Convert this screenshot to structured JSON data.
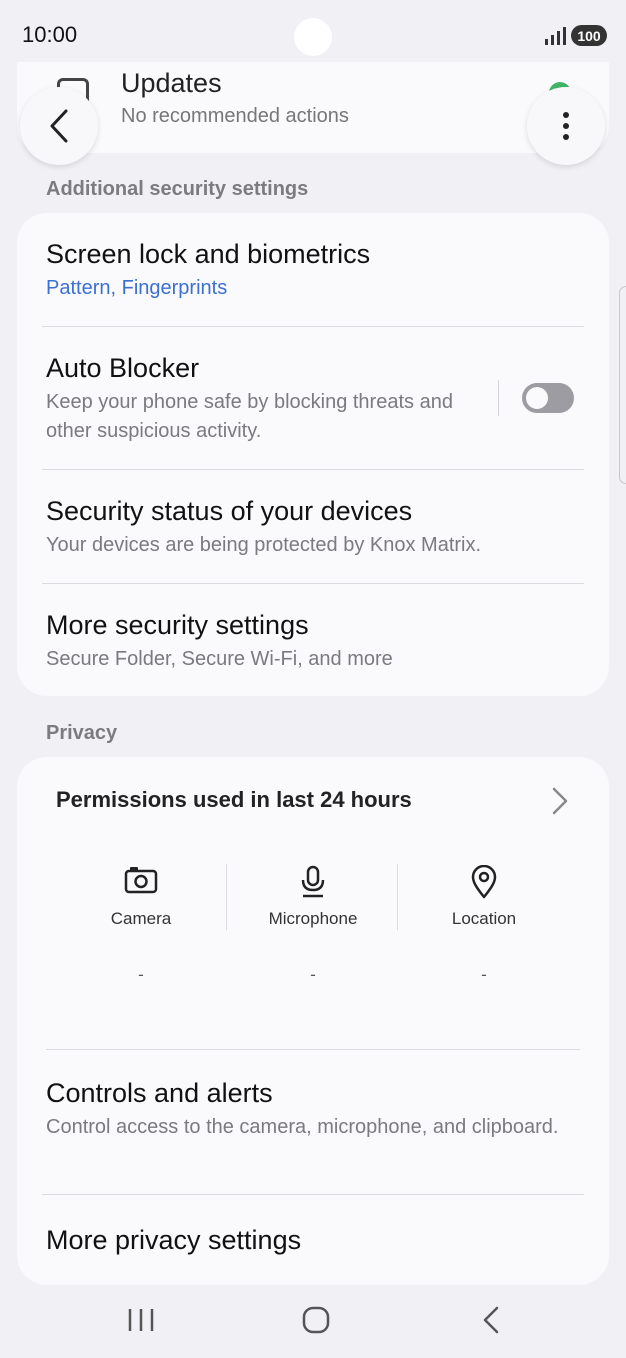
{
  "status_bar": {
    "time": "10:00",
    "battery": "100"
  },
  "updates": {
    "title": "Updates",
    "subtitle": "No recommended actions"
  },
  "security": {
    "section_label": "Additional security settings",
    "items": [
      {
        "title": "Screen lock and biometrics",
        "subtitle": "Pattern, Fingerprints"
      },
      {
        "title": "Auto Blocker",
        "subtitle": "Keep your phone safe by blocking threats and other suspicious activity.",
        "toggle_on": false
      },
      {
        "title": "Security status of your devices",
        "subtitle": "Your devices are being protected by Knox Matrix."
      },
      {
        "title": "More security settings",
        "subtitle": "Secure Folder, Secure Wi-Fi, and more"
      }
    ]
  },
  "privacy": {
    "section_label": "Privacy",
    "permissions_title": "Permissions used in last 24 hours",
    "permissions": [
      {
        "label": "Camera",
        "value": "-",
        "icon": "camera-icon"
      },
      {
        "label": "Microphone",
        "value": "-",
        "icon": "microphone-icon"
      },
      {
        "label": "Location",
        "value": "-",
        "icon": "location-icon"
      }
    ],
    "items": [
      {
        "title": "Controls and alerts",
        "subtitle": "Control access to the camera, microphone, and clipboard."
      },
      {
        "title": "More privacy settings"
      }
    ]
  },
  "colors": {
    "accent_link": "#3b6fd0",
    "background": "#f1f1f5",
    "card": "#fafafc"
  }
}
